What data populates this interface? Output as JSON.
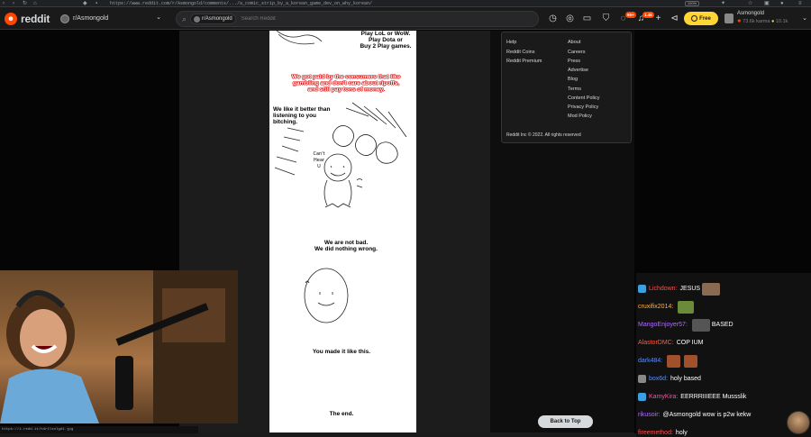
{
  "browser": {
    "url": "https://www.reddit.com/r/Asmongold/comments/.../a_comic_strip_by_a_korean_game_dev_on_why_korean/",
    "zoom": "100%"
  },
  "header": {
    "logo_text": "reddit",
    "community": "r/Asmongold",
    "search_chip": "r/Asmongold",
    "search_placeholder": "Search Reddit",
    "chat_badge": "99+",
    "notif_badge": "1.4k",
    "free_label": "Free",
    "username": "Asmongold",
    "karma": "73.6k karma",
    "coins": "10.1k"
  },
  "comic": {
    "text_top": "Play LoL or WoW.\nPlay Dota or\nBuy 2 Play games.",
    "text_paid": "We got paid by the consumers that like\ngambling and don't care about ripoffs,\nand still pay tons of money.",
    "text_better": "We like it better than\nlistening to you bitching.",
    "doodle_text": "Can't\nHear\nU",
    "text_not_bad": "We are not bad.\nWe did nothing wrong.",
    "text_made": "You made it like this.",
    "text_end": "The end."
  },
  "footer": {
    "col1": [
      "Help",
      "Reddit Coins",
      "Reddit Premium"
    ],
    "col2": [
      "About",
      "Careers",
      "Press",
      "Advertise",
      "Blog",
      "Terms",
      "Content Policy",
      "Privacy Policy",
      "Mod Policy"
    ],
    "copyright": "Reddit Inc © 2022. All rights reserved"
  },
  "back_to_top": "Back to Top",
  "webcam_caption": "https://i.redd.it/h4r1lsnlgd1.jpg",
  "chat": [
    {
      "user": "Lichdown",
      "text": "JESUS",
      "color": "#ff4d4d"
    },
    {
      "user": "cruxifix2014",
      "text": "",
      "color": "#ffb347"
    },
    {
      "user": "MangoEnjoyer57",
      "text": "BASED",
      "color": "#b06bff"
    },
    {
      "user": "AlastorDMC",
      "text": "COP IUM",
      "color": "#ff5a3c"
    },
    {
      "user": "dark484",
      "text": "",
      "color": "#5b8cff"
    },
    {
      "user": "box6d",
      "text": "holy based",
      "color": "#5b8cff"
    },
    {
      "user": "KamyKira",
      "text": "EERRRIIIEEE Mussslik",
      "color": "#ff4fa0"
    },
    {
      "user": "rikusoir",
      "text": "@Asmongold wow is p2w kekw",
      "color": "#b06bff"
    },
    {
      "user": "fireemethod",
      "text": "holy",
      "color": "#ff4d4d"
    }
  ]
}
